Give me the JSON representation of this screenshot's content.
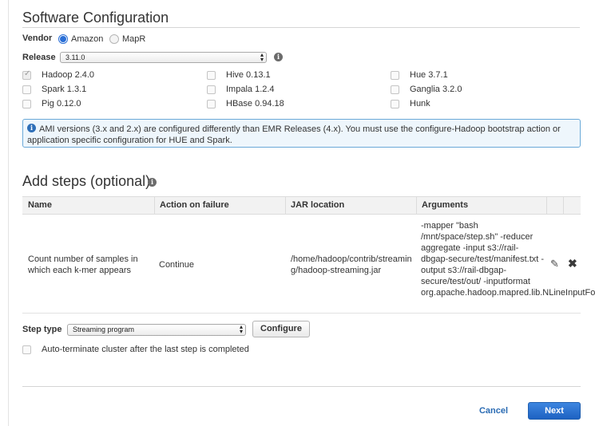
{
  "software_configuration": {
    "title": "Software Configuration",
    "vendor_label": "Vendor",
    "vendor_options": [
      "Amazon",
      "MapR"
    ],
    "vendor_selected": "Amazon",
    "release_label": "Release",
    "release_value": "3.11.0",
    "applications": [
      {
        "label": "Hadoop 2.4.0",
        "checked": true
      },
      {
        "label": "Hive 0.13.1",
        "checked": false
      },
      {
        "label": "Hue 3.7.1",
        "checked": false
      },
      {
        "label": "Spark 1.3.1",
        "checked": false
      },
      {
        "label": "Impala 1.2.4",
        "checked": false
      },
      {
        "label": "Ganglia 3.2.0",
        "checked": false
      },
      {
        "label": "Pig 0.12.0",
        "checked": false
      },
      {
        "label": "HBase 0.94.18",
        "checked": false
      },
      {
        "label": "Hunk",
        "checked": false
      }
    ],
    "notice": "AMI versions (3.x and 2.x) are configured differently than EMR Releases (4.x). You must use the configure-Hadoop bootstrap action or application specific configuration for HUE and Spark."
  },
  "steps": {
    "title": "Add steps (optional)",
    "columns": [
      "Name",
      "Action on failure",
      "JAR location",
      "Arguments"
    ],
    "rows": [
      {
        "name": "Count number of samples in which each k-mer appears",
        "action_on_failure": "Continue",
        "jar_location": "/home/hadoop/contrib/streaming/hadoop-streaming.jar",
        "arguments": "-mapper \"bash /mnt/space/step.sh\" -reducer aggregate -input s3://rail-dbgap-secure/test/manifest.txt -output s3://rail-dbgap-secure/test/out/ -inputformat org.apache.hadoop.mapred.lib.NLineInputFormat"
      }
    ],
    "step_type_label": "Step type",
    "step_type_value": "Streaming program",
    "configure_label": "Configure",
    "auto_terminate_label": "Auto-terminate cluster after the last step is completed",
    "auto_terminate_checked": false
  },
  "footer": {
    "cancel_label": "Cancel",
    "next_label": "Next"
  },
  "colors": {
    "accent": "#2a6fd6",
    "next_button": "#1e62c2",
    "notice_border": "#6aa9d8",
    "notice_bg": "#eef6fc"
  }
}
